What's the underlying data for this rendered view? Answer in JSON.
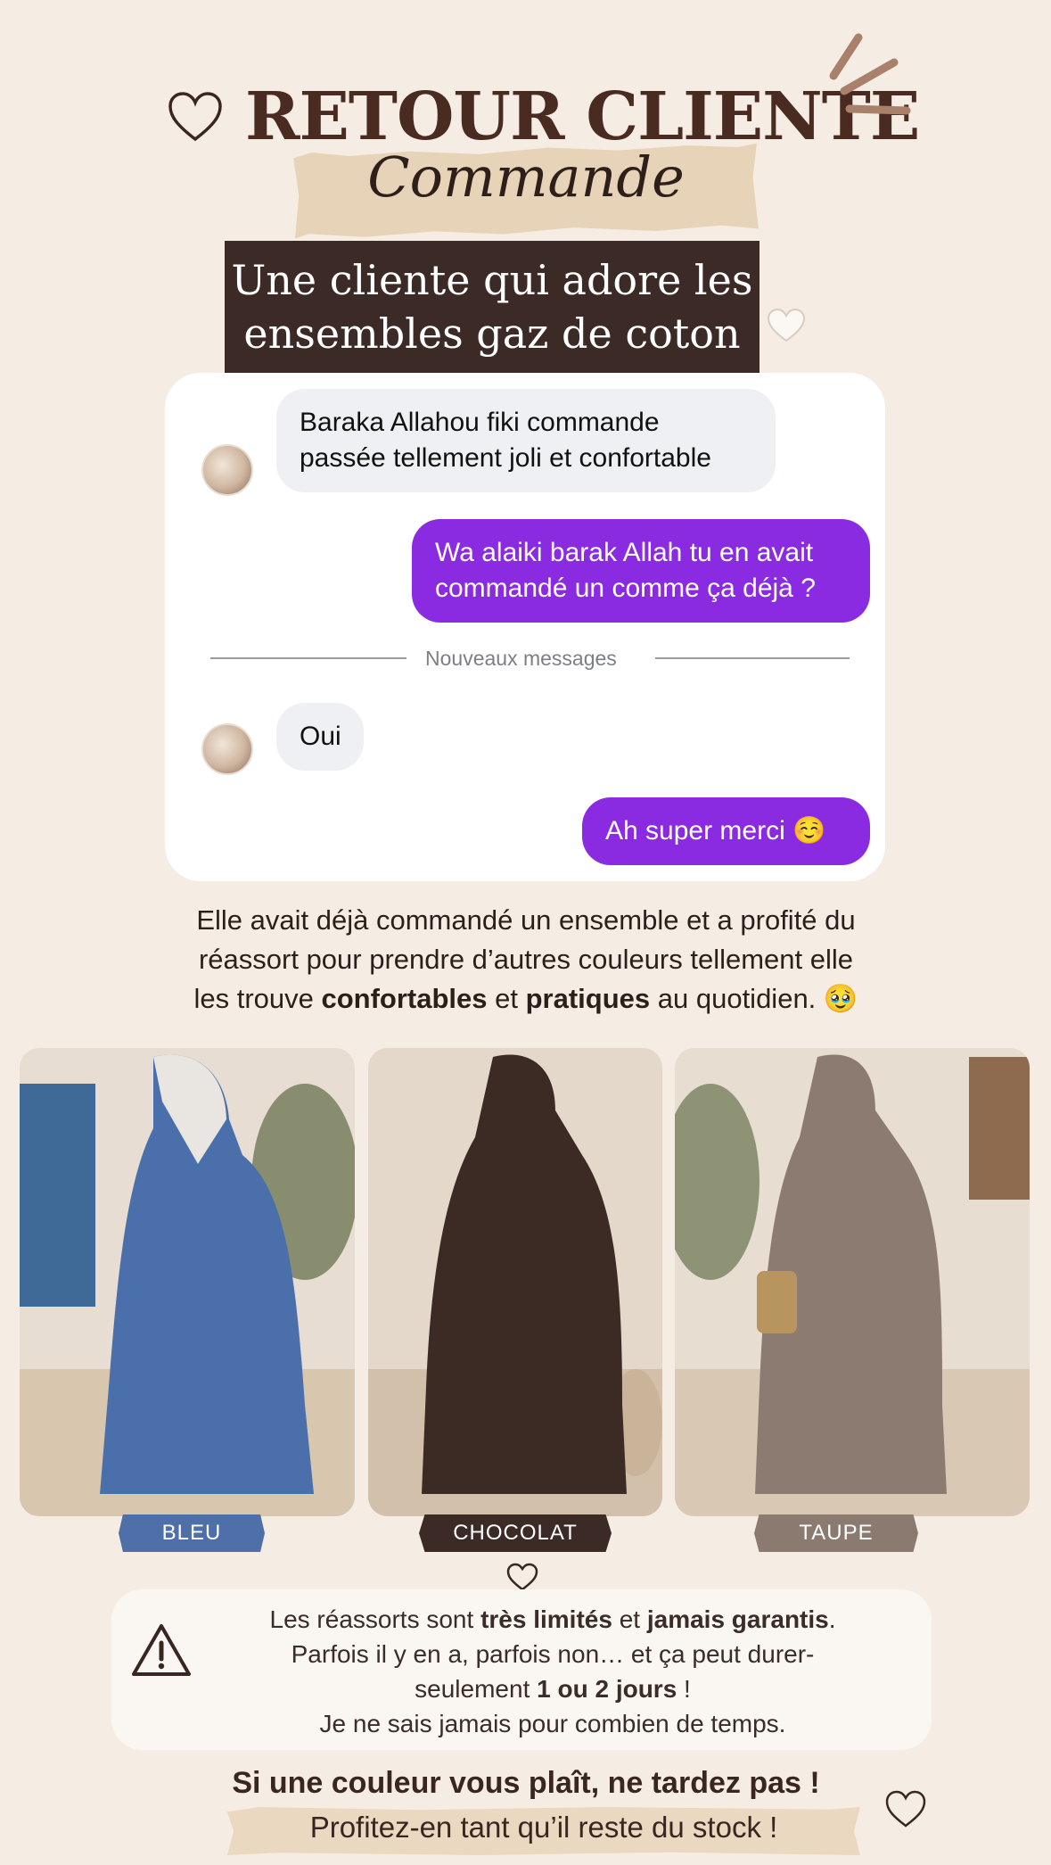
{
  "header": {
    "title": "RETOUR CLIENTE",
    "subtitle_script": "Commande",
    "banner_lines": [
      "Une cliente qui adore les",
      "ensembles gaz de coton"
    ]
  },
  "chat": {
    "messages": [
      {
        "direction": "in",
        "lines": [
          "Baraka Allahou fiki commande",
          "passée tellement joli et confortable"
        ]
      },
      {
        "direction": "out",
        "lines": [
          "Wa alaiki barak Allah tu en avait",
          "commandé un comme ça déjà ?"
        ]
      },
      {
        "direction": "in",
        "lines": [
          "Oui"
        ]
      },
      {
        "direction": "out",
        "lines": [
          "Ah super merci ☺️"
        ]
      }
    ],
    "divider": "Nouveaux messages"
  },
  "description": {
    "line1": "Elle avait déjà commandé un ensemble et a profité du",
    "line2": "réassort pour prendre d’autres couleurs tellement elle",
    "line3_pre": "les trouve ",
    "line3_b1": "confortables",
    "line3_mid": " et ",
    "line3_b2": "pratiques",
    "line3_post": " au quotidien. 🥹"
  },
  "products": [
    {
      "label": "BLEU",
      "color": "#4f6fa8"
    },
    {
      "label": "CHOCOLAT",
      "color": "#3b2a25"
    },
    {
      "label": "TAUPE",
      "color": "#8b7a70"
    }
  ],
  "notice": {
    "l1_pre": "Les réassorts sont ",
    "l1_b1": "très limités",
    "l1_mid": " et ",
    "l1_b2": "jamais garantis",
    "l1_post": ".",
    "l2": "Parfois il y en a, parfois non… et ça peut durer-",
    "l3_pre": "seulement ",
    "l3_b": "1 ou 2 jours",
    "l3_post": " !",
    "l4": "Je ne sais jamais pour combien de temps."
  },
  "cta": {
    "line1": "Si une couleur vous plaît, ne tardez pas !",
    "line2": "Profitez-en tant qu’il reste du stock !"
  },
  "colors": {
    "background": "#f5ede4",
    "title": "#4a2b22",
    "bubble_out": "#8a2be2",
    "bubble_in": "#eff0f4"
  }
}
